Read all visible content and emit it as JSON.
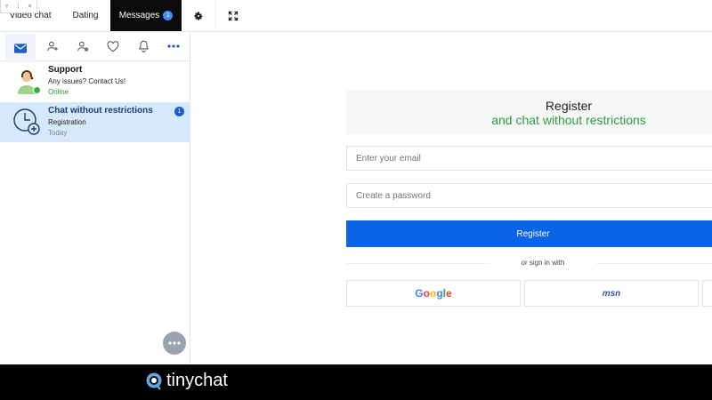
{
  "topnav": {
    "tabs": [
      {
        "label": "Video chat"
      },
      {
        "label": "Dating"
      },
      {
        "label": "Messages",
        "badge": "1",
        "active": true
      }
    ],
    "icons": [
      "gear-icon",
      "fullscreen-icon"
    ]
  },
  "sidebar": {
    "tab_icons": [
      "envelope-icon",
      "add-user-icon",
      "user-star-icon",
      "heart-icon",
      "bell-icon",
      "more-icon"
    ],
    "chats": [
      {
        "title": "Support",
        "subtitle": "Any issues? Contact Us!",
        "status": "Online"
      },
      {
        "title": "Chat without restrictions",
        "subtitle": "Registration",
        "status": "Today",
        "unread": "1"
      }
    ]
  },
  "register": {
    "title": "Register",
    "subtitle": "and chat without restrictions",
    "email_placeholder": "Enter your email",
    "password_placeholder": "Create a password",
    "button_label": "Register",
    "or_text": "or sign in with",
    "providers": [
      "Google",
      "msn"
    ]
  },
  "brand": {
    "name": "tinychat"
  },
  "colors": {
    "accent": "#0b63e6",
    "green": "#2f9e36",
    "active_tab_bg": "#0b0b0b",
    "highlight": "#d6e8fb"
  }
}
